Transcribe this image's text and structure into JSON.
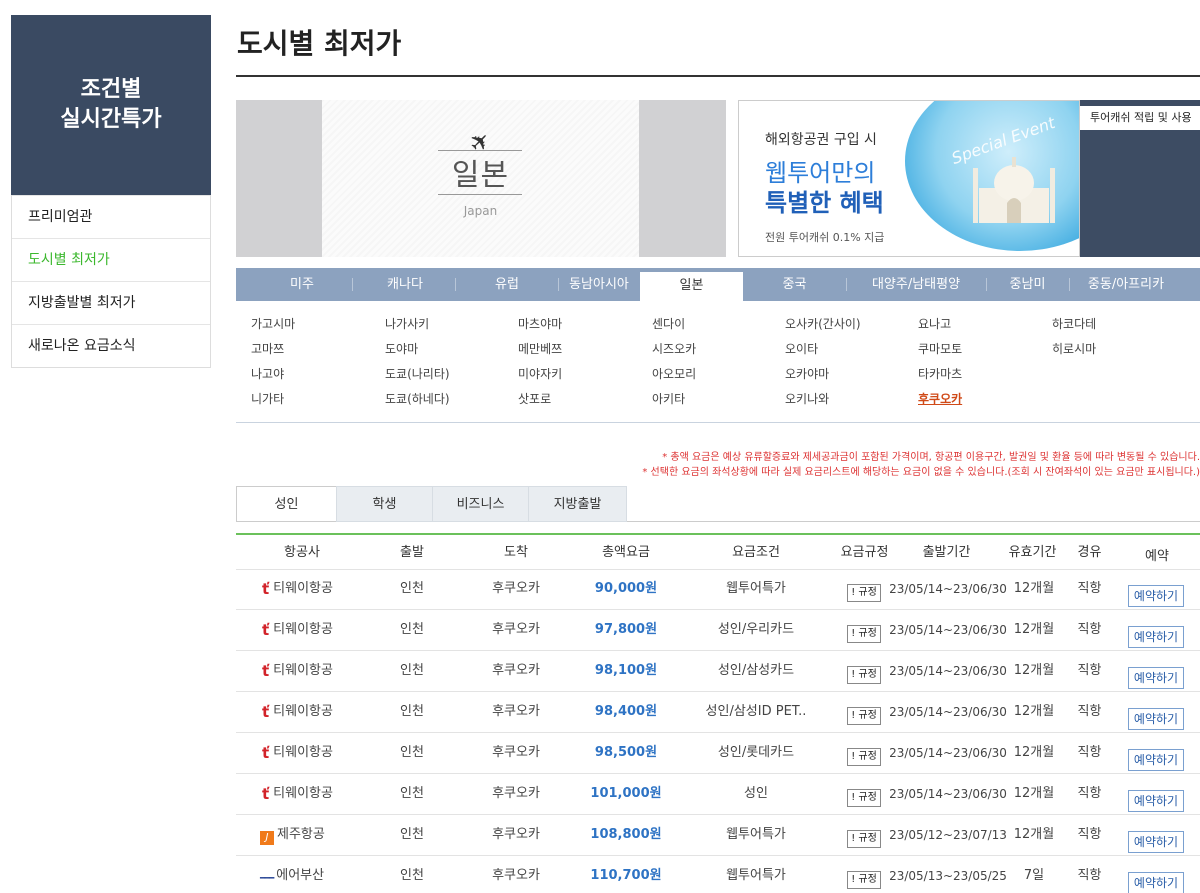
{
  "sidebar": {
    "title_line1": "조건별",
    "title_line2": "실시간특가",
    "items": [
      {
        "label": "프리미엄관"
      },
      {
        "label": "도시별 최저가"
      },
      {
        "label": "지방출발별 최저가"
      },
      {
        "label": "새로나온 요금소식"
      }
    ]
  },
  "page": {
    "title": "도시별 최저가"
  },
  "banner": {
    "city_kr": "일본",
    "city_en": "Japan",
    "promo_line1": "해외항공권 구입 시",
    "promo_line2": "웹투어만의",
    "promo_line3": "특별한 혜택",
    "promo_line4": "전원 투어캐쉬 0.1% 지급",
    "promo_badge": "Special Event",
    "side_tab": "투어캐쉬 적립 및 사용"
  },
  "regions": [
    "미주",
    "캐나다",
    "유럽",
    "동남아시아",
    "일본",
    "중국",
    "대양주/남태평양",
    "중남미",
    "중동/아프리카"
  ],
  "active_region": "일본",
  "cities": [
    [
      "가고시마",
      "고마쯔",
      "나고야",
      "니가타"
    ],
    [
      "나가사키",
      "도야마",
      "도쿄(나리타)",
      "도쿄(하네다)"
    ],
    [
      "마츠야마",
      "메만베쯔",
      "미야자키",
      "삿포로"
    ],
    [
      "센다이",
      "시즈오카",
      "아오모리",
      "아키타"
    ],
    [
      "오사카(간사이)",
      "오이타",
      "오카야마",
      "오키나와"
    ],
    [
      "요나고",
      "쿠마모토",
      "타카마츠",
      "후쿠오카"
    ],
    [
      "하코다테",
      "히로시마"
    ]
  ],
  "selected_city": "후쿠오카",
  "notices": [
    "* 총액 요금은 예상 유류할증료와 제세공과금이 포함된 가격이며, 항공편 이용구간, 발권일 및 환율 등에 따라 변동될 수 있습니다.",
    "* 선택한 요금의 좌석상황에 따라 실제 요금리스트에 해당하는 요금이 없을 수 있습니다.(조회 시 잔여좌석이 있는 요금만 표시됩니다.)"
  ],
  "fare_tabs": [
    "성인",
    "학생",
    "비즈니스",
    "지방출발"
  ],
  "active_fare_tab": "성인",
  "table": {
    "headers": [
      "항공사",
      "출발",
      "도착",
      "총액요금",
      "요금조건",
      "요금규정",
      "출발기간",
      "유효기간",
      "경유",
      "예약"
    ],
    "rule_label": "! 규정",
    "book_label": "예약하기",
    "rows": [
      {
        "airline": "티웨이항공",
        "logo": "tway",
        "dep": "인천",
        "arr": "후쿠오카",
        "price": "90,000원",
        "cond": "웹투어특가",
        "period": "23/05/14~23/06/30",
        "valid": "12개월",
        "stop": "직항"
      },
      {
        "airline": "티웨이항공",
        "logo": "tway",
        "dep": "인천",
        "arr": "후쿠오카",
        "price": "97,800원",
        "cond": "성인/우리카드",
        "period": "23/05/14~23/06/30",
        "valid": "12개월",
        "stop": "직항"
      },
      {
        "airline": "티웨이항공",
        "logo": "tway",
        "dep": "인천",
        "arr": "후쿠오카",
        "price": "98,100원",
        "cond": "성인/삼성카드",
        "period": "23/05/14~23/06/30",
        "valid": "12개월",
        "stop": "직항"
      },
      {
        "airline": "티웨이항공",
        "logo": "tway",
        "dep": "인천",
        "arr": "후쿠오카",
        "price": "98,400원",
        "cond": "성인/삼성ID PET..",
        "period": "23/05/14~23/06/30",
        "valid": "12개월",
        "stop": "직항"
      },
      {
        "airline": "티웨이항공",
        "logo": "tway",
        "dep": "인천",
        "arr": "후쿠오카",
        "price": "98,500원",
        "cond": "성인/롯데카드",
        "period": "23/05/14~23/06/30",
        "valid": "12개월",
        "stop": "직항"
      },
      {
        "airline": "티웨이항공",
        "logo": "tway",
        "dep": "인천",
        "arr": "후쿠오카",
        "price": "101,000원",
        "cond": "성인",
        "period": "23/05/14~23/06/30",
        "valid": "12개월",
        "stop": "직항"
      },
      {
        "airline": "제주항공",
        "logo": "jeju",
        "dep": "인천",
        "arr": "후쿠오카",
        "price": "108,800원",
        "cond": "웹투어특가",
        "period": "23/05/12~23/07/13",
        "valid": "12개월",
        "stop": "직항"
      },
      {
        "airline": "에어부산",
        "logo": "busan",
        "dep": "인천",
        "arr": "후쿠오카",
        "price": "110,700원",
        "cond": "웹투어특가",
        "period": "23/05/13~23/05/25",
        "valid": "7일",
        "stop": "직항"
      }
    ]
  },
  "colors": {
    "sidebar_bg": "#3a4a62",
    "region_bar": "#8ca2bf",
    "active_green": "#3cb82e",
    "price_blue": "#2e73c4",
    "selected_city": "#d04a18"
  }
}
